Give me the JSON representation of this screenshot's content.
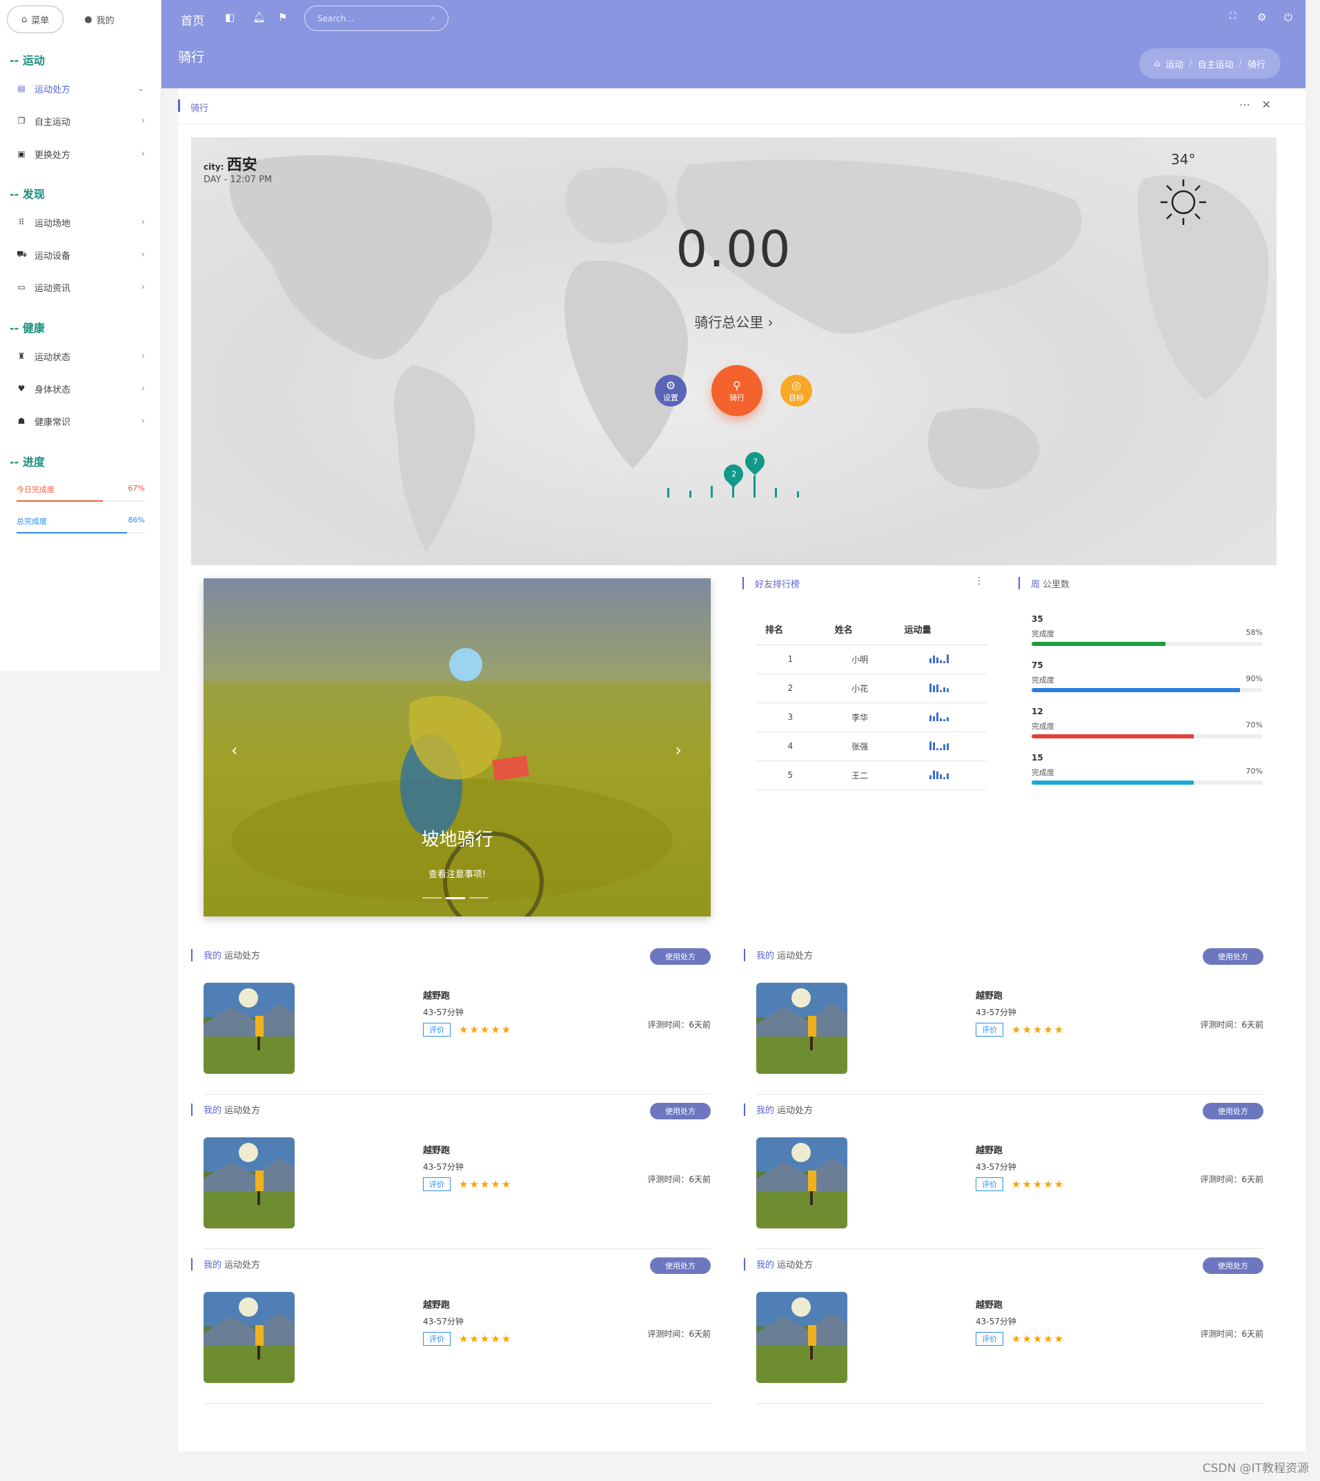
{
  "sidebar": {
    "tabs": [
      {
        "label": "菜单",
        "icon": "home-icon"
      },
      {
        "label": "我的",
        "icon": "user-icon"
      }
    ],
    "sections": [
      {
        "title": "运动",
        "items": [
          {
            "label": "运动处方",
            "icon": "book-icon",
            "active": true
          },
          {
            "label": "自主运动",
            "icon": "copy-icon"
          },
          {
            "label": "更换处方",
            "icon": "calendar-icon"
          }
        ]
      },
      {
        "title": "发现",
        "items": [
          {
            "label": "运动场地",
            "icon": "grid-icon"
          },
          {
            "label": "运动设备",
            "icon": "cart-icon"
          },
          {
            "label": "运动资讯",
            "icon": "monitor-icon"
          }
        ]
      },
      {
        "title": "健康",
        "items": [
          {
            "label": "运动状态",
            "icon": "run-icon"
          },
          {
            "label": "身体状态",
            "icon": "heart-icon"
          },
          {
            "label": "健康常识",
            "icon": "basket-icon"
          }
        ]
      },
      {
        "title": "进度",
        "items": []
      }
    ],
    "progress": [
      {
        "label": "今日完成度",
        "value": "67%",
        "fraction": 0.67,
        "color": "#f0603f"
      },
      {
        "label": "总完成度",
        "value": "86%",
        "fraction": 0.86,
        "color": "#2d8cf0"
      }
    ]
  },
  "topbar": {
    "home": "首页",
    "search_placeholder": "Search...",
    "page_title": "骑行",
    "breadcrumb": [
      "运动",
      "自主运动",
      "骑行"
    ]
  },
  "card": {
    "title": "骑行"
  },
  "hero": {
    "city_label": "city:",
    "city": "西安",
    "time": "DAY - 12:07 PM",
    "temperature": "34°",
    "total_km": "0.00",
    "total_label": "骑行总公里",
    "buttons": [
      {
        "label": "设置",
        "color": "#5a64b8"
      },
      {
        "label": "骑行",
        "color": "#f4622e"
      },
      {
        "label": "目标",
        "color": "#f9a825"
      }
    ],
    "pins": [
      "2",
      "7"
    ]
  },
  "carousel": {
    "title": "坡地骑行",
    "subtitle": "查看注意事项!"
  },
  "ranking": {
    "title": "好友排行榜",
    "columns": [
      "排名",
      "姓名",
      "运动量"
    ],
    "rows": [
      {
        "rank": "1",
        "name": "小明",
        "spark": [
          0.5,
          0.8,
          0.6,
          0.3,
          0.2,
          0.9
        ]
      },
      {
        "rank": "2",
        "name": "小花",
        "spark": [
          0.9,
          0.7,
          0.8,
          0.2,
          0.5,
          0.4
        ]
      },
      {
        "rank": "3",
        "name": "李华",
        "spark": [
          0.6,
          0.5,
          0.9,
          0.3,
          0.2,
          0.4
        ]
      },
      {
        "rank": "4",
        "name": "张强",
        "spark": [
          0.9,
          0.8,
          0.2,
          0.2,
          0.6,
          0.7
        ]
      },
      {
        "rank": "5",
        "name": "王二",
        "spark": [
          0.4,
          0.9,
          0.8,
          0.5,
          0.2,
          0.6
        ]
      }
    ]
  },
  "weekly": {
    "title_strong": "周",
    "title_rest": "公里数",
    "done_label": "完成度",
    "items": [
      {
        "km": "35",
        "pct": "58%",
        "fraction": 0.58,
        "color": "#1e9e3a"
      },
      {
        "km": "75",
        "pct": "90%",
        "fraction": 0.9,
        "color": "#2b7de0"
      },
      {
        "km": "12",
        "pct": "70%",
        "fraction": 0.7,
        "color": "#e2403a"
      },
      {
        "km": "15",
        "pct": "70%",
        "fraction": 0.7,
        "color": "#19a9d6"
      }
    ]
  },
  "prescription": {
    "my": "我的",
    "label": "运动处方",
    "use": "使用处方",
    "name": "越野跑",
    "duration": "43-57分钟",
    "badge": "评价",
    "stars": "★★★★★",
    "time": "评测时间：6天前"
  },
  "watermark": "CSDN @IT教程资源"
}
